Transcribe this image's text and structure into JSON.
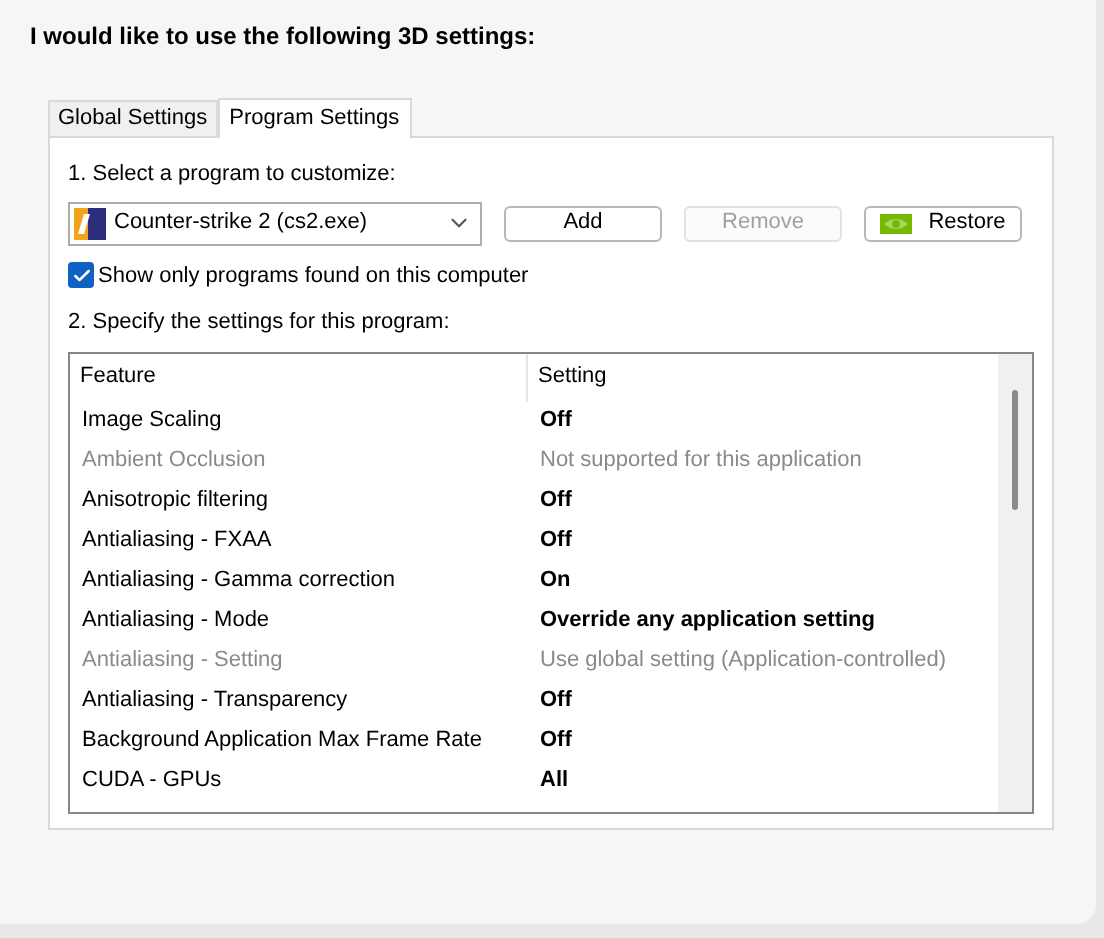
{
  "heading": "I would like to use the following 3D settings:",
  "tabs": [
    {
      "label": "Global Settings",
      "selected": false
    },
    {
      "label": "Program Settings",
      "selected": true
    }
  ],
  "step_1": "1. Select a program to customize:",
  "program_select": {
    "value": "Counter-strike 2 (cs2.exe)"
  },
  "buttons": [
    {
      "label": "Add",
      "disabled": false,
      "kind": "plain"
    },
    {
      "label": "Remove",
      "disabled": true,
      "kind": "plain"
    },
    {
      "label": "Restore",
      "disabled": false,
      "kind": "logo"
    }
  ],
  "filter_checkbox": {
    "label": "Show only programs found on this computer",
    "checked": true
  },
  "step_2": "2. Specify the settings for this program:",
  "table": {
    "columns": [
      "Feature",
      "Setting"
    ],
    "rows": [
      {
        "feature": "Image Scaling",
        "setting": "Off",
        "disabled": false
      },
      {
        "feature": "Ambient Occlusion",
        "setting": "Not supported for this application",
        "disabled": true
      },
      {
        "feature": "Anisotropic filtering",
        "setting": "Off",
        "disabled": false
      },
      {
        "feature": "Antialiasing - FXAA",
        "setting": "Off",
        "disabled": false
      },
      {
        "feature": "Antialiasing - Gamma correction",
        "setting": "On",
        "disabled": false
      },
      {
        "feature": "Antialiasing - Mode",
        "setting": "Override any application setting",
        "disabled": false
      },
      {
        "feature": "Antialiasing - Setting",
        "setting": "Use global setting (Application-controlled)",
        "disabled": true
      },
      {
        "feature": "Antialiasing - Transparency",
        "setting": "Off",
        "disabled": false
      },
      {
        "feature": "Background Application Max Frame Rate",
        "setting": "Off",
        "disabled": false
      },
      {
        "feature": "CUDA - GPUs",
        "setting": "All",
        "disabled": false
      }
    ]
  }
}
